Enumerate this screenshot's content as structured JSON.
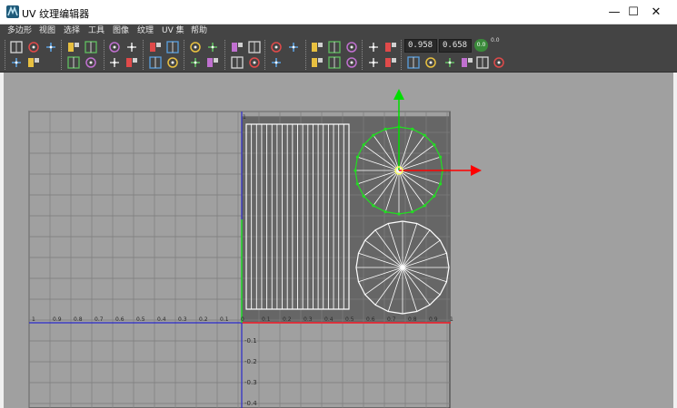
{
  "window": {
    "title": "UV 纹理编辑器",
    "minimize_glyph": "—",
    "maximize_glyph": "☐",
    "close_glyph": "✕"
  },
  "menu": [
    "多边形",
    "视图",
    "选择",
    "工具",
    "图像",
    "纹理",
    "UV 集",
    "帮助"
  ],
  "toolbar": {
    "u_value": "0.958",
    "v_value": "0.658",
    "step_label": "0.0",
    "offset_label": "0.0",
    "icons_row1": [
      "uv-frame-icon",
      "uv-camera-icon",
      "uv-unfold-icon",
      "flip-horizontal-icon",
      "flip-vertical-icon",
      "cut-uv-icon",
      "sew-uv-icon",
      "move-sew-icon",
      "layout-uv-icon",
      "align-left-icon",
      "align-right-icon",
      "snapshot-icon",
      "grid-uv-icon",
      "texture-display-icon",
      "checker-icon",
      "pixel-snap-icon",
      "rotate-ccw-icon",
      "smooth-uv-icon",
      "checker-map-icon",
      "prev-image-icon",
      "coord-pick-icon",
      "coord-copy-icon"
    ],
    "icons_row2": [
      "select-shell-icon",
      "select-border-icon",
      "red-dot-icon",
      "orbit-icon",
      "straighten-icon",
      "grab-icon",
      "normalize-icon",
      "distribute-icon",
      "stack-icon",
      "align-bottom-icon",
      "align-top-icon",
      "grid-snap-icon",
      "shell-bounds-icon",
      "color-management-icon",
      "dim-image-icon",
      "checkerboard-icon",
      "copy-uv-icon",
      "paste-uv-icon",
      "pin-icon",
      "unpin-icon",
      "lock-icon",
      "gear-icon"
    ]
  },
  "viewport": {
    "colors": {
      "background": "#a0a0a0",
      "grid_line": "#7d7d7d",
      "grid_frame": "#333333",
      "uv_tile": "#666666",
      "tile_grid_line": "#7a7a7a",
      "u_axis": "#ff2222",
      "v_axis": "#2a2acc",
      "uv_wire": "#ffffff",
      "selection": "#22dd22",
      "manip_x": "#ff0000",
      "manip_y": "#00dd00"
    },
    "u_labels": [
      "1",
      "0.9",
      "0.8",
      "0.7",
      "0.6",
      "0.5",
      "0.4",
      "0.3",
      "0.2",
      "0.1",
      "0",
      "0.1",
      "0.2",
      "0.3",
      "0.4",
      "0.5",
      "0.6",
      "0.7",
      "0.8",
      "0.9",
      "1"
    ],
    "v_labels": [
      "0.1",
      "0.2",
      "0.3",
      "0.4"
    ],
    "v_top_label": "1",
    "v_zero_label": "0",
    "rect_stripes": 20,
    "circle_spokes": 20
  }
}
